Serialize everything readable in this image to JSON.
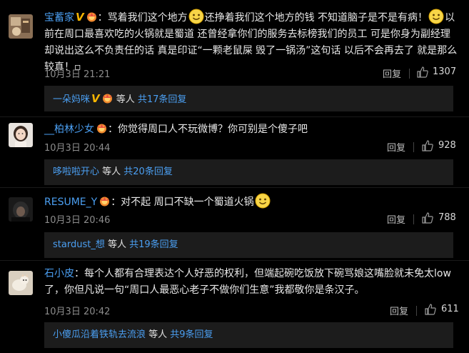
{
  "comments": [
    {
      "username": "宝蓄家",
      "verified_mark": "V",
      "text_parts": [
        "：骂着我们这个地方",
        "还挣着我们这个地方的钱 不知道脑子是不是有病！",
        "以前在周口最喜欢吃的火锅就是蜀道 还曾经拿你们的服务去标榜我们的员工 可是你身为副经理却说出这么不负责任的话 真是印证“一颗老鼠屎 毁了一锅汤”这句话 以后不会再去了 就是那么较真！▫"
      ],
      "time": "10月3日 21:21",
      "reply_label": "回复",
      "likes": "1307",
      "thread": {
        "who": "一朵妈咪",
        "verified_mark": "V",
        "mid": " 等人 ",
        "count": "共17条回复"
      }
    },
    {
      "username": "__柏林少女",
      "text": "：你觉得周口人不玩微博？你可别是个傻子吧",
      "time": "10月3日 20:44",
      "reply_label": "回复",
      "likes": "928",
      "thread": {
        "who": "哆啦啦开心",
        "mid": " 等人 ",
        "count": "共20条回复"
      }
    },
    {
      "username": "RESUME_Y",
      "text": "：对不起 周口不缺一个蜀道火锅",
      "time": "10月3日 20:46",
      "reply_label": "回复",
      "likes": "788",
      "thread": {
        "who": "stardust_想",
        "mid": " 等人 ",
        "count": "共19条回复"
      }
    },
    {
      "username": "石小皮",
      "text": "：每个人都有合理表达个人好恶的权利，但端起碗吃饭放下碗骂娘这嘴脸就未免太low了，你但凡说一句“周口人最恶心老子不做你们生意”我都敬你是条汉子。",
      "time": "10月3日 20:42",
      "reply_label": "回复",
      "likes": "611",
      "thread": {
        "who": "小傻瓜沿着铁轨去流浪",
        "mid": " 等人 ",
        "count": "共9条回复"
      }
    }
  ],
  "colors": {
    "background": "#000000",
    "username": "#4b9ff2",
    "text": "#e8e8e8",
    "meta": "#8c8c8c",
    "thread_bg": "#1c1c1c",
    "verified": "#f7b500"
  },
  "icons": [
    "avatar",
    "verified-v-icon",
    "vip-crown-badge-icon",
    "smiley-emoji-icon",
    "thumb-up-icon"
  ]
}
